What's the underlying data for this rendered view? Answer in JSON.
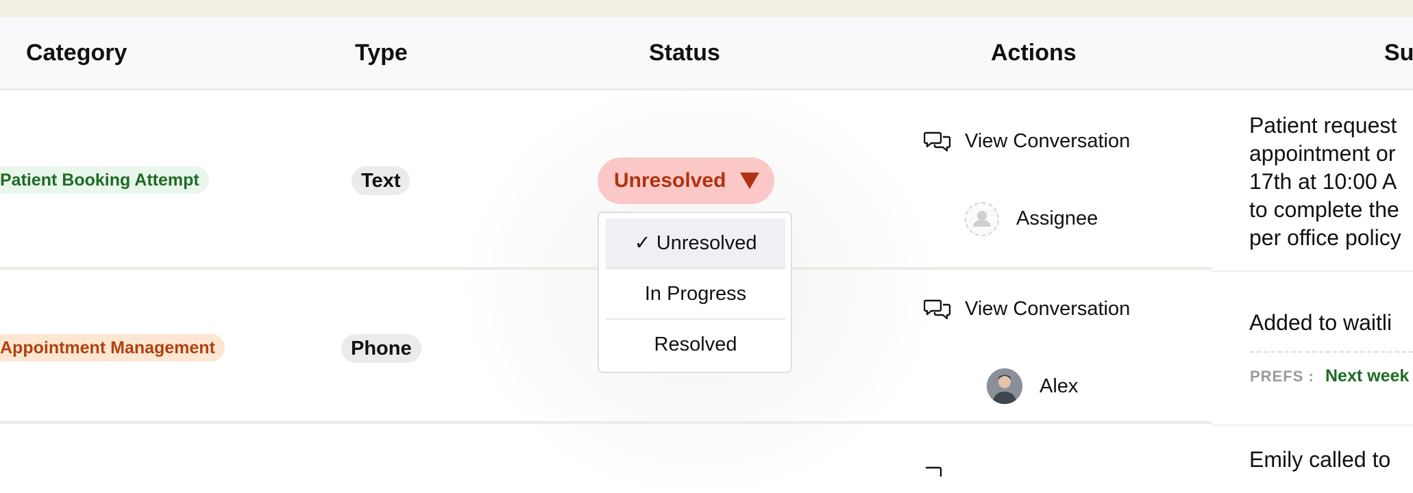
{
  "columns": [
    "Category",
    "Type",
    "Status",
    "Actions",
    "Su"
  ],
  "rows": [
    {
      "category": "Patient Booking Attempt",
      "type": "Text",
      "status": "Unresolved",
      "view_conversation": "View Conversation",
      "assignee": "Assignee",
      "summary_lines": [
        "Patient request",
        "appointment or",
        "17th at 10:00 A",
        "to complete the",
        "per office policy"
      ]
    },
    {
      "category": "Appointment Management",
      "type": "Phone",
      "view_conversation": "View Conversation",
      "assignee": "Alex",
      "summary_lines": [
        "Added to waitli"
      ],
      "prefs_label": "PREFS :",
      "prefs_value": "Next week"
    },
    {
      "summary_lines": [
        "Emily called to"
      ]
    }
  ],
  "status_menu": {
    "options": [
      "✓ Unresolved",
      "In Progress",
      "Resolved"
    ],
    "selected": "Unresolved"
  },
  "colors": {
    "status_unresolved_bg": "#fbc8c7",
    "status_unresolved_text": "#b0320f",
    "category_green": "#1f6b24",
    "category_orange": "#b0410f"
  }
}
